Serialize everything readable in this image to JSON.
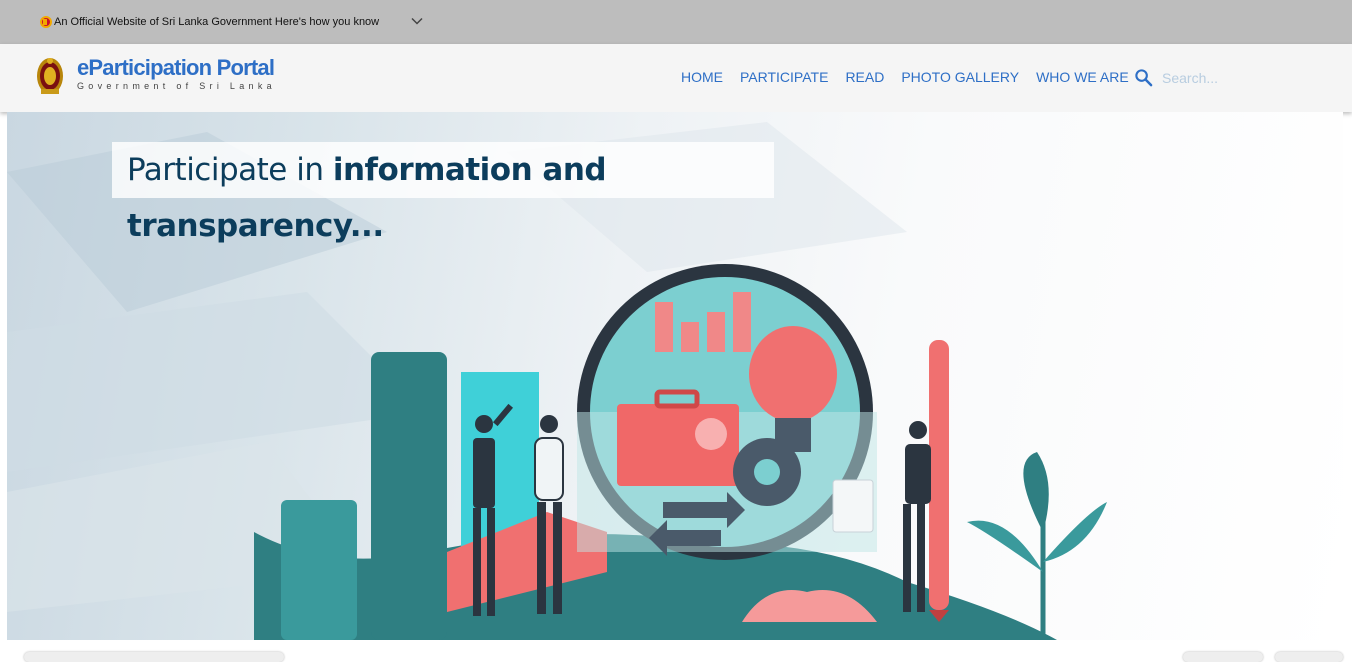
{
  "gov_banner": {
    "text": "An Official Website of Sri Lanka Government Here's how you know",
    "flag_icon": "sri-lanka-flag-icon",
    "expand_icon": "chevron-down-icon"
  },
  "header": {
    "logo_icon": "sri-lanka-emblem-icon",
    "title": "eParticipation Portal",
    "subtitle": "Government of Sri Lanka",
    "nav": [
      {
        "label": "HOME"
      },
      {
        "label": "PARTICIPATE"
      },
      {
        "label": "READ"
      },
      {
        "label": "PHOTO GALLERY"
      },
      {
        "label": "WHO WE ARE"
      }
    ],
    "search": {
      "icon": "search-icon",
      "placeholder": "Search..."
    }
  },
  "hero": {
    "title_prefix": "Participate in ",
    "title_bold": "information and transparency..."
  },
  "colors": {
    "brand_blue": "#2e6fc6",
    "hero_text": "#0c3d5c",
    "teal": "#2f7f82",
    "coral": "#f07070"
  }
}
